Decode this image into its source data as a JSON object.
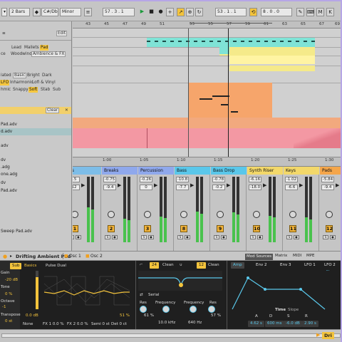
{
  "transport": {
    "quantize": "2 Bars",
    "key": "C#/Db",
    "scale": "Minor",
    "position": "57 . 3 . 1",
    "loop_start": "53 . 1 . 1",
    "loop_length": "8 . 0 . 0"
  },
  "browser": {
    "edit_label": "Edit",
    "category_rows": [
      [
        "Lead",
        "Mallets",
        "Pad"
      ],
      [
        "ce",
        "Woodwind",
        "Ambience & FX"
      ]
    ],
    "tag_rows": [
      [
        "iated",
        "Basic",
        "Bright",
        "Dark"
      ],
      [
        "LFO",
        "Inharmonic",
        "Lofi & Vinyl"
      ],
      [
        "hmic",
        "Snappy",
        "Soft",
        "Stab",
        "Sub"
      ]
    ],
    "clear_label": "Clear",
    "files": [
      "Pad.adv",
      "d.adv",
      "",
      "adv",
      "",
      "dv",
      "",
      ".adg",
      "one.adg",
      "dv",
      "Pad.adv",
      "",
      "",
      "",
      "",
      "Sweep Pad.adv"
    ]
  },
  "ruler": {
    "bars": [
      "43",
      "45",
      "47",
      "49",
      "51",
      "53",
      "55",
      "57",
      "59",
      "61",
      "63",
      "65",
      "67",
      "69"
    ],
    "times": [
      "1:00",
      "1:05",
      "1:10",
      "1:15",
      "1:20",
      "1:25",
      "1:30"
    ]
  },
  "mixer": {
    "strips": [
      {
        "name": "ms",
        "val1": "0.5",
        "val2": "-12",
        "num": "1",
        "color": "#7dbde8"
      },
      {
        "name": "Breaks",
        "val1": "-0.75",
        "val2": "-9.4",
        "num": "2",
        "color": "#8fa8ec"
      },
      {
        "name": "Percussion",
        "val1": "-0.26",
        "val2": "0",
        "num": "3",
        "color": "#8fa8ec"
      },
      {
        "name": "Bass",
        "val1": "-10.8",
        "val2": "-7.7",
        "num": "8",
        "color": "#5ac7ea"
      },
      {
        "name": "Bass Drop",
        "val1": "-0.78",
        "val2": "-0.2",
        "num": "9",
        "color": "#5ac7ea"
      },
      {
        "name": "Synth Riser",
        "val1": "-6.16",
        "val2": "-18.0",
        "num": "10",
        "color": "#f3d86a"
      },
      {
        "name": "Keys",
        "val1": "-1.02",
        "val2": "-6.6",
        "num": "11",
        "color": "#f3d86a"
      },
      {
        "name": "Pads",
        "val1": "-5.84",
        "val2": "-9.4",
        "num": "12",
        "color": "#f5a64a"
      }
    ]
  },
  "device": {
    "track_title": "Drifting Ambient Pad",
    "tabs": [
      "Osc 1",
      "Osc 2"
    ],
    "sub_label": "Sub",
    "gain_label": "Gain",
    "gain_value": "-20 dB",
    "tone_label": "Tone",
    "tone_value": "0 %",
    "octave_label": "Octave",
    "octave_value": "-1",
    "transpose_label": "Transpose",
    "transpose_value": "0 st",
    "osc_mode": "Basics",
    "osc_type": "Pulse Dual",
    "osc_level": "0.0 dB",
    "osc_width": "51 %",
    "fx1": "FX 1 0.0 %",
    "fx2": "FX 2 0.0 %",
    "semi": "Semi 0 st",
    "det": "Det 0 ct",
    "none_label": "None",
    "filter1_label": "Clean",
    "filter1_num": "24",
    "filter2_label": "Clean",
    "filter2_num": "12",
    "serial_label": "Serial",
    "res_label": "Res",
    "res_value": "61 %",
    "freq_label": "Frequency",
    "freq_value": "10.0 kHz",
    "freq2_label": "Frequency",
    "freq2_value": "640 Hz",
    "res2_label": "Res",
    "res2_value": "57 %",
    "mod_tabs": [
      "Mod Sources",
      "Matrix",
      "MIDI",
      "MPE"
    ],
    "env_tabs": [
      "Amp",
      "Env 2",
      "Env 3",
      "LFO 1",
      "LFO 2"
    ],
    "env_none": "None",
    "time_label": "Time",
    "slope_label": "Slope",
    "adsr_letters": [
      "A",
      "D",
      "S",
      "R"
    ],
    "adsr_values": [
      "4.62 s",
      "600 ms",
      "-6.0 dB",
      "2.90 s"
    ]
  },
  "status": {
    "track_label": "Dri"
  }
}
